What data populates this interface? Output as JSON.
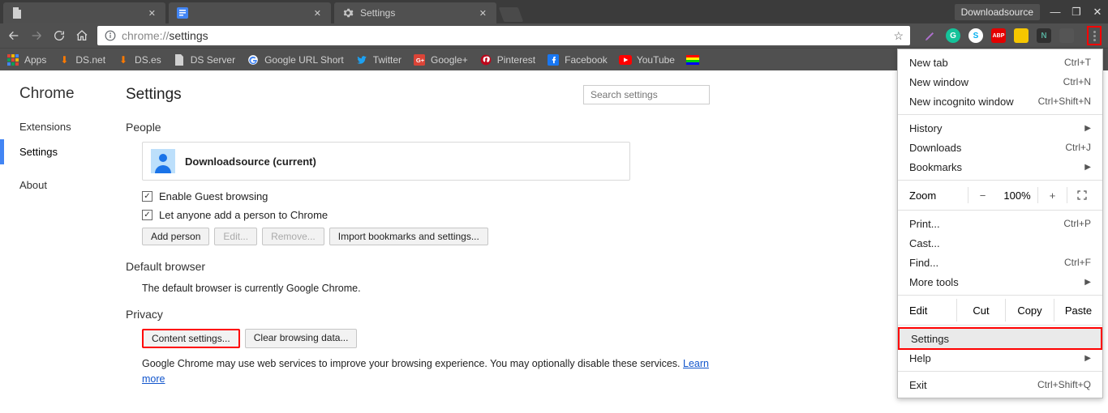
{
  "titlebar": {
    "tabs": [
      {
        "label": "",
        "icon": "doc"
      },
      {
        "label": "",
        "icon": "gdoc"
      },
      {
        "label": "Settings",
        "icon": "gear"
      }
    ],
    "user_badge": "Downloadsource"
  },
  "navbar": {
    "url_proto": "chrome://",
    "url_path": "settings"
  },
  "bookmarks": {
    "apps": "Apps",
    "items": [
      {
        "label": "DS.net",
        "color": "#ff7a00"
      },
      {
        "label": "DS.es",
        "color": "#ff7a00"
      },
      {
        "label": "DS Server",
        "color": "#fff",
        "doc": true
      },
      {
        "label": "Google URL Short",
        "color": "#4285f4",
        "g": true
      },
      {
        "label": "Twitter",
        "color": "#1da1f2",
        "tw": true
      },
      {
        "label": "Google+",
        "color": "#db4437",
        "gp": true
      },
      {
        "label": "Pinterest",
        "color": "#bd081c",
        "pin": true
      },
      {
        "label": "Facebook",
        "color": "#1877f2",
        "fb": true
      },
      {
        "label": "YouTube",
        "color": "#ff0000",
        "yt": true
      }
    ]
  },
  "ext_icons": [
    {
      "name": "pen",
      "bg": "transparent",
      "txt": "",
      "color": "#b070d0"
    },
    {
      "name": "grammarly",
      "bg": "#15c39a",
      "txt": "G"
    },
    {
      "name": "skype",
      "bg": "#fff",
      "txt": "S",
      "fg": "#00aff0"
    },
    {
      "name": "abp",
      "bg": "#e40000",
      "txt": "ABP"
    },
    {
      "name": "yellow",
      "bg": "#f6c700",
      "txt": ""
    },
    {
      "name": "n",
      "bg": "#303030",
      "txt": "N",
      "fg": "#5a9"
    },
    {
      "name": "square",
      "bg": "#555",
      "txt": ""
    }
  ],
  "sidebar": {
    "brand": "Chrome",
    "items": [
      "Extensions",
      "Settings",
      "About"
    ],
    "selected_idx": 1
  },
  "settings": {
    "page_title": "Settings",
    "search_placeholder": "Search settings",
    "sections": {
      "people": {
        "title": "People",
        "profile_name": "Downloadsource (current)",
        "chk_guest": "Enable Guest browsing",
        "chk_add_person": "Let anyone add a person to Chrome",
        "btn_add": "Add person",
        "btn_edit": "Edit...",
        "btn_remove": "Remove...",
        "btn_import": "Import bookmarks and settings..."
      },
      "default_browser": {
        "title": "Default browser",
        "desc": "The default browser is currently Google Chrome."
      },
      "privacy": {
        "title": "Privacy",
        "btn_content": "Content settings...",
        "btn_clear": "Clear browsing data...",
        "desc_a": "Google Chrome may use web services to improve your browsing experience. You may optionally disable these services. ",
        "learn_more": "Learn more"
      }
    }
  },
  "menu": {
    "new_tab": "New tab",
    "new_tab_sc": "Ctrl+T",
    "new_window": "New window",
    "new_window_sc": "Ctrl+N",
    "incognito": "New incognito window",
    "incognito_sc": "Ctrl+Shift+N",
    "history": "History",
    "downloads": "Downloads",
    "downloads_sc": "Ctrl+J",
    "bookmarks": "Bookmarks",
    "zoom": "Zoom",
    "zoom_val": "100%",
    "print": "Print...",
    "print_sc": "Ctrl+P",
    "cast": "Cast...",
    "find": "Find...",
    "find_sc": "Ctrl+F",
    "more_tools": "More tools",
    "edit": "Edit",
    "cut": "Cut",
    "copy": "Copy",
    "paste": "Paste",
    "settings": "Settings",
    "help": "Help",
    "exit": "Exit",
    "exit_sc": "Ctrl+Shift+Q"
  }
}
